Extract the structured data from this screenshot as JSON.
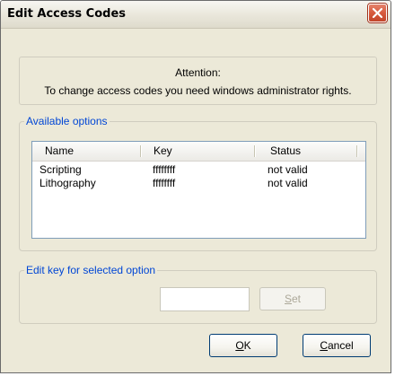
{
  "window": {
    "title": "Edit Access Codes"
  },
  "attention": {
    "title": "Attention:",
    "message": "To change access codes you need windows administrator rights."
  },
  "options_group": {
    "legend": "Available options",
    "columns": [
      "Name",
      "Key",
      "Status"
    ],
    "rows": [
      {
        "name": "Scripting",
        "key": "ffffffff",
        "status": "not valid"
      },
      {
        "name": "Lithography",
        "key": "ffffffff",
        "status": "not valid"
      }
    ]
  },
  "edit_key_group": {
    "legend": "Edit key for selected option",
    "key_value": "",
    "set_button": {
      "accel": "S",
      "rest": "et",
      "enabled": false
    }
  },
  "footer": {
    "ok_button": {
      "accel": "O",
      "rest": "K"
    },
    "cancel_button": {
      "accel": "C",
      "rest": "ancel"
    }
  },
  "colors": {
    "dialog_bg": "#ece9d8",
    "legend_text": "#0046d5",
    "close_button": "#d65a3d",
    "button_border": "#003c74",
    "disabled_text": "#aca899"
  },
  "icons": {
    "close": "close-icon"
  }
}
